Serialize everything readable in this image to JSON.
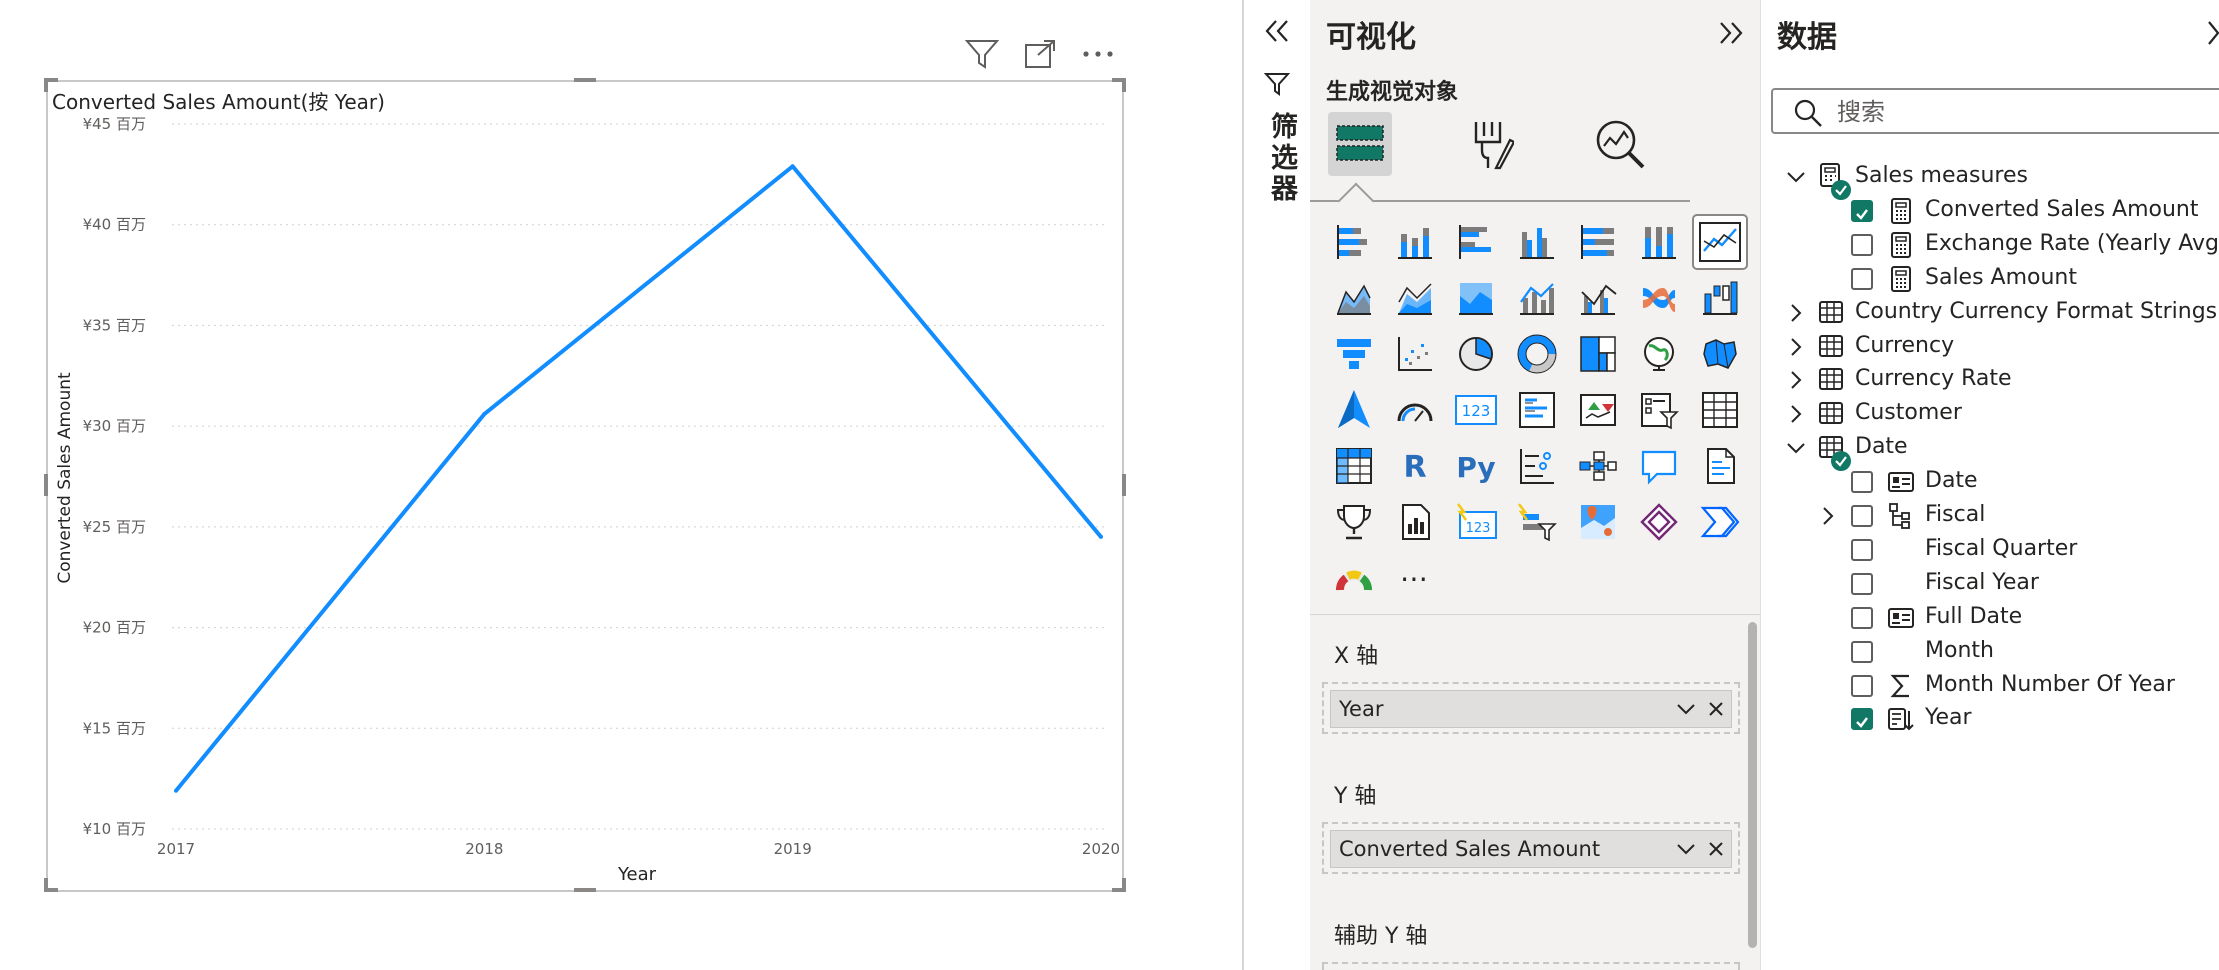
{
  "canvas": {
    "chart_title": "Converted Sales Amount(按 Year)",
    "header_icons": [
      "filter-icon",
      "focus-mode-icon",
      "more-options-icon"
    ]
  },
  "chart_data": {
    "type": "line",
    "title": "Converted Sales Amount(按 Year)",
    "xlabel": "Year",
    "ylabel": "Converted Sales Amount",
    "categories": [
      "2017",
      "2018",
      "2019",
      "2020"
    ],
    "series": [
      {
        "values": [
          11.9,
          30.6,
          42.9,
          24.5
        ]
      }
    ],
    "ylim": [
      10,
      45
    ],
    "yticks": [
      10,
      15,
      20,
      25,
      30,
      35,
      40,
      45
    ],
    "ytick_labels": [
      "¥10 百万",
      "¥15 百万",
      "¥20 百万",
      "¥25 百万",
      "¥30 百万",
      "¥35 百万",
      "¥40 百万",
      "¥45 百万"
    ],
    "grid": true,
    "line_color": "#118DFF"
  },
  "filters": {
    "label": "筛选器"
  },
  "visualizations": {
    "title": "可视化",
    "subtitle": "生成视觉对象",
    "modes": [
      "build-visual-icon",
      "format-visual-icon",
      "analytics-icon"
    ],
    "gallery": [
      "stacked-bar-chart",
      "stacked-column-chart",
      "clustered-bar-chart",
      "clustered-column-chart",
      "100-stacked-bar-chart",
      "100-stacked-column-chart",
      "line-chart",
      "area-chart",
      "stacked-area-chart",
      "100-stacked-area-chart",
      "line-and-stacked-column-chart",
      "line-and-clustered-column-chart",
      "ribbon-chart",
      "waterfall-chart",
      "funnel-chart",
      "scatter-chart",
      "pie-chart",
      "donut-chart",
      "treemap",
      "map",
      "filled-map",
      "azure-map",
      "gauge",
      "card",
      "multi-row-card",
      "kpi",
      "slicer",
      "table",
      "matrix",
      "r-script-visual",
      "python-visual",
      "key-influencers",
      "decomposition-tree",
      "q-and-a",
      "paginated-report",
      "goals",
      "narrative",
      "new-card",
      "new-slicer",
      "arcgis-map",
      "power-apps",
      "power-automate",
      "custom-visual",
      "more-visuals"
    ],
    "r_glyph": "R",
    "py_glyph": "Py",
    "card_glyph": "123",
    "more_glyph": "⋯",
    "wells": [
      {
        "label": "X 轴",
        "field": "Year"
      },
      {
        "label": "Y 轴",
        "field": "Converted Sales Amount"
      },
      {
        "label": "辅助 Y 轴",
        "field": ""
      }
    ]
  },
  "data": {
    "title": "数据",
    "search_placeholder": "搜索",
    "tree": [
      {
        "label": "Sales measures",
        "kind": "measure-table",
        "expanded": true,
        "level": 0,
        "badge": true
      },
      {
        "label": "Converted Sales Amount",
        "kind": "measure",
        "checked": true,
        "level": 1
      },
      {
        "label": "Exchange Rate (Yearly Avg)",
        "kind": "measure",
        "checked": false,
        "level": 1
      },
      {
        "label": "Sales Amount",
        "kind": "measure",
        "checked": false,
        "level": 1
      },
      {
        "label": "Country Currency Format Strings",
        "kind": "table",
        "expanded": false,
        "level": 0
      },
      {
        "label": "Currency",
        "kind": "table",
        "expanded": false,
        "level": 0
      },
      {
        "label": "Currency Rate",
        "kind": "table",
        "expanded": false,
        "level": 0
      },
      {
        "label": "Customer",
        "kind": "table",
        "expanded": false,
        "level": 0
      },
      {
        "label": "Date",
        "kind": "table",
        "expanded": true,
        "level": 0,
        "badge": true
      },
      {
        "label": "Date",
        "kind": "date-field",
        "checked": false,
        "level": 1
      },
      {
        "label": "Fiscal",
        "kind": "hierarchy",
        "checked": false,
        "level": 1,
        "expandable": true
      },
      {
        "label": "Fiscal Quarter",
        "kind": "text",
        "checked": false,
        "level": 1
      },
      {
        "label": "Fiscal Year",
        "kind": "text",
        "checked": false,
        "level": 1
      },
      {
        "label": "Full Date",
        "kind": "date-field",
        "checked": false,
        "level": 1
      },
      {
        "label": "Month",
        "kind": "text",
        "checked": false,
        "level": 1
      },
      {
        "label": "Month Number Of Year",
        "kind": "sum",
        "checked": false,
        "level": 1
      },
      {
        "label": "Year",
        "kind": "sort-field",
        "checked": true,
        "level": 1
      }
    ]
  }
}
